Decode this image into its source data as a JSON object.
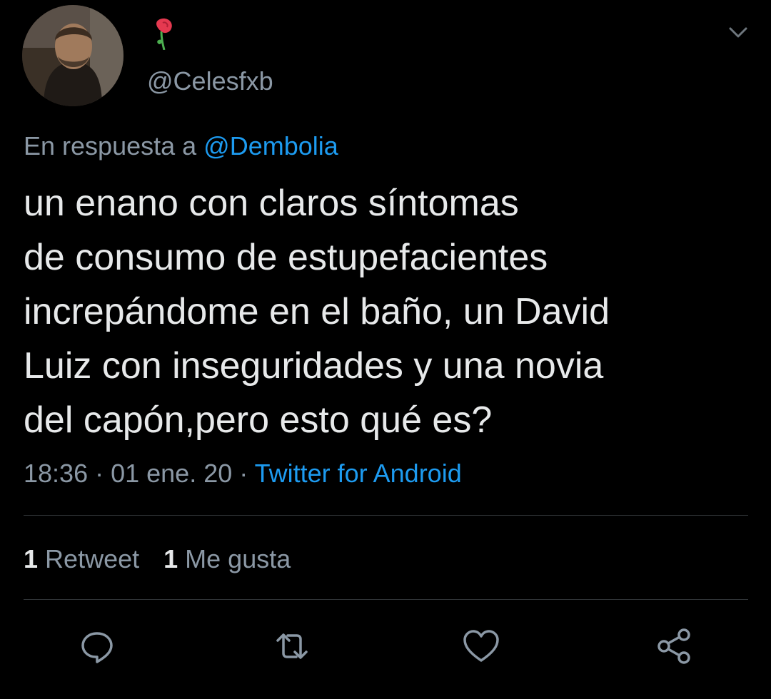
{
  "author": {
    "handle": "@Celesfxb",
    "avatar_icon": "profile-photo",
    "name_emoji_icon": "wilted-rose-icon"
  },
  "reply": {
    "prefix": "En respuesta a ",
    "mention": "@Dembolia"
  },
  "tweet": {
    "text": "un enano con claros síntomas\nde consumo de estupefacientes\nincrepándome en el baño, un David\nLuiz con inseguridades y una novia\ndel capón,pero esto qué es?"
  },
  "meta": {
    "time": "18:36",
    "separator": " · ",
    "date": "01 ene. 20",
    "source": "Twitter for Android"
  },
  "stats": {
    "retweets_count": "1",
    "retweets_label": "Retweet",
    "likes_count": "1",
    "likes_label": "Me gusta"
  },
  "actions": {
    "icons": [
      "reply-icon",
      "retweet-icon",
      "like-icon",
      "share-icon"
    ]
  },
  "colors": {
    "background": "#000000",
    "text_primary": "#e7e9ea",
    "text_secondary": "#8b98a5",
    "accent": "#1d9bf0",
    "divider": "#2f3336"
  }
}
